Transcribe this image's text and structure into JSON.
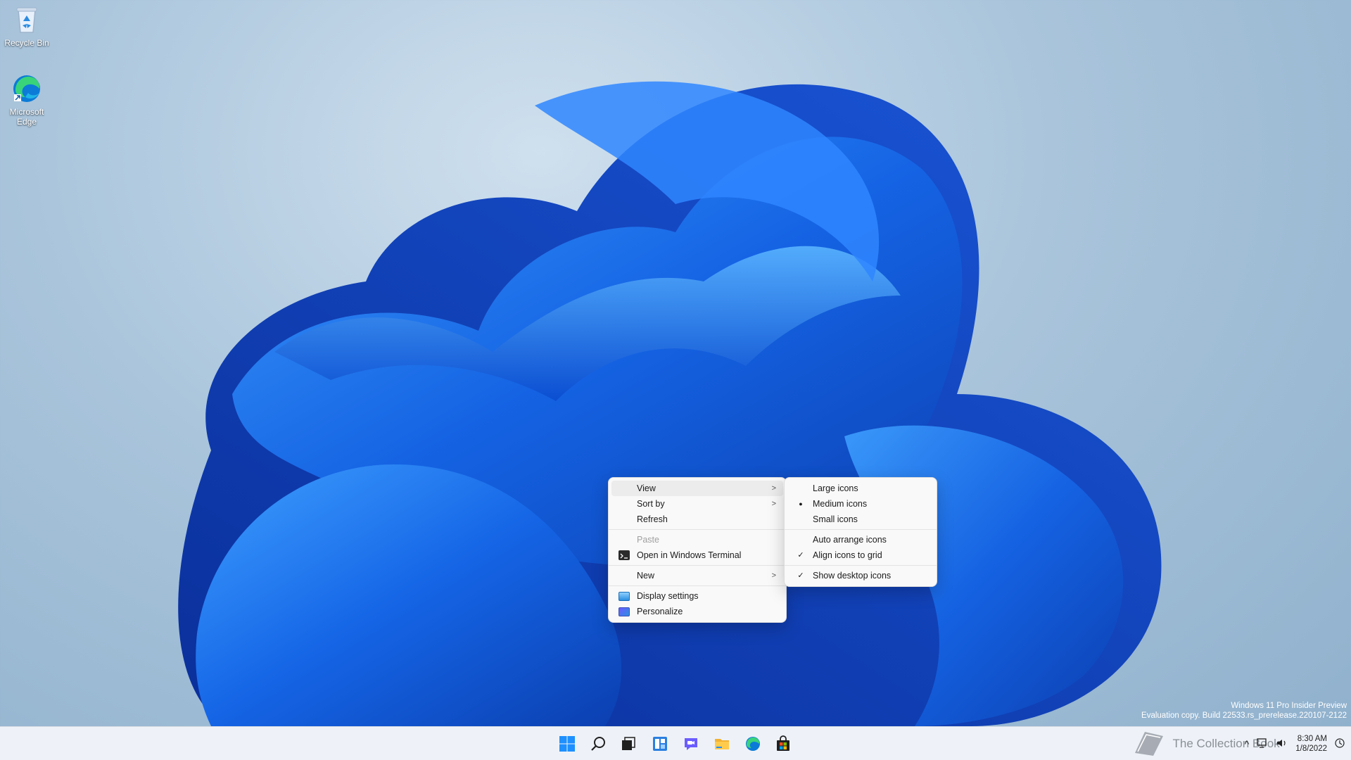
{
  "desktop": {
    "icons": [
      {
        "label": "Recycle Bin",
        "icon": "recycle-bin-icon"
      },
      {
        "label": "Microsoft Edge",
        "icon": "edge-icon"
      }
    ]
  },
  "context_menu": {
    "items": [
      {
        "label": "View",
        "has_submenu": true
      },
      {
        "label": "Sort by",
        "has_submenu": true
      },
      {
        "label": "Refresh"
      },
      {
        "label": "Paste",
        "disabled": true
      },
      {
        "label": "Open in Windows Terminal",
        "icon": "terminal-icon"
      },
      {
        "label": "New",
        "has_submenu": true
      },
      {
        "label": "Display settings",
        "icon": "display-icon"
      },
      {
        "label": "Personalize",
        "icon": "personalize-icon"
      }
    ],
    "arrow": ">"
  },
  "view_submenu": {
    "items": [
      {
        "label": "Large icons"
      },
      {
        "label": "Medium icons",
        "mark": "●"
      },
      {
        "label": "Small icons"
      },
      {
        "label": "Auto arrange icons"
      },
      {
        "label": "Align icons to grid",
        "mark": "✓"
      },
      {
        "label": "Show desktop icons",
        "mark": "✓"
      }
    ]
  },
  "watermark": {
    "line1": "Windows 11 Pro Insider Preview",
    "line2": "Evaluation copy. Build 22533.rs_prerelease.220107-2122"
  },
  "taskbar": {
    "apps": [
      "start-icon",
      "search-icon",
      "task-view-icon",
      "widgets-icon",
      "chat-icon",
      "file-explorer-icon",
      "edge-icon",
      "store-icon"
    ],
    "tray": {
      "chevron": "^",
      "time": "8:30 AM",
      "date": "1/8/2022"
    }
  },
  "overlay_text": "The Collection Book",
  "colors": {
    "accent": "#0067c0",
    "menu_bg": "#f9f9f9",
    "taskbar_bg": "#eef2f8"
  }
}
